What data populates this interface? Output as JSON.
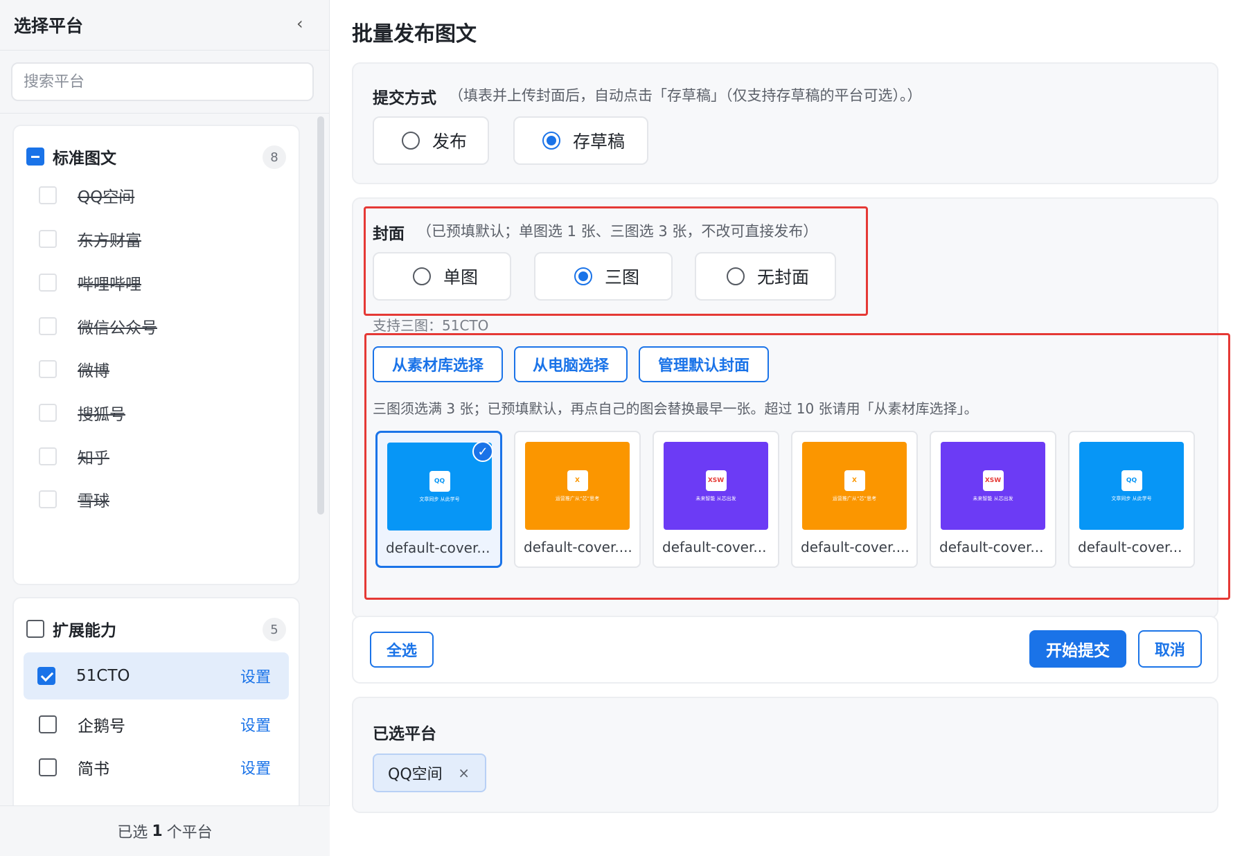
{
  "sidebar": {
    "title": "选择平台",
    "collapse_icon": "‹",
    "search_placeholder": "搜索平台",
    "groups": [
      {
        "name": "标准图文",
        "count": "8",
        "state": "partial",
        "items": [
          {
            "label": "QQ空间",
            "strike": true
          },
          {
            "label": "东方财富",
            "strike": true
          },
          {
            "label": "哔哩哔哩",
            "strike": true
          },
          {
            "label": "微信公众号",
            "strike": true
          },
          {
            "label": "微博",
            "strike": true
          },
          {
            "label": "搜狐号",
            "strike": true
          },
          {
            "label": "知乎",
            "strike": true
          },
          {
            "label": "雪球",
            "strike": true
          }
        ]
      },
      {
        "name": "扩展能力",
        "count": "5",
        "state": "unchecked",
        "items": [
          {
            "label": "51CTO",
            "checked": true,
            "action": "设置"
          },
          {
            "label": "企鹅号",
            "checked": false,
            "action": "设置"
          },
          {
            "label": "简书",
            "checked": false,
            "action": "设置"
          }
        ]
      }
    ],
    "footer": {
      "prefix": "已选",
      "count": "1",
      "suffix": "个平台"
    }
  },
  "main": {
    "title": "批量发布图文",
    "submit": {
      "label": "提交方式",
      "hint": "（填表并上传封面后，自动点击「存草稿」（仅支持存草稿的平台可选）。）",
      "options": [
        "发布",
        "存草稿"
      ],
      "selected": "存草稿"
    },
    "cover": {
      "label": "封面",
      "hint": "（已预填默认；单图选 1 张、三图选 3 张，不改可直接发布）",
      "options": [
        "单图",
        "三图",
        "无封面"
      ],
      "selected": "三图",
      "support_text": "支持三图：51CTO",
      "buttons": [
        "从素材库选择",
        "从电脑选择",
        "管理默认封面"
      ],
      "note": "三图须选满 3 张；已预填默认，再点自己的图会替换最早一张。超过 10 张请用「从素材库选择」。",
      "thumbnails": [
        {
          "name": "default-cover...",
          "color": "#0796f6",
          "logo_text": "QQ",
          "logo_color": "#0796f6",
          "tag": "文章同步 从此学号",
          "selected": true
        },
        {
          "name": "default-cover....",
          "color": "#fb9600",
          "logo_text": "X",
          "logo_color": "#fb9600",
          "tag": "运营推广从“芯”思考",
          "selected": false
        },
        {
          "name": "default-cover...",
          "color": "#6c3bf5",
          "logo_text": "XSW",
          "logo_color": "#e53935",
          "tag": "未来智能 从芯出发",
          "selected": false
        },
        {
          "name": "default-cover....",
          "color": "#fb9600",
          "logo_text": "X",
          "logo_color": "#fb9600",
          "tag": "运营推广从“芯”思考",
          "selected": false
        },
        {
          "name": "default-cover...",
          "color": "#6c3bf5",
          "logo_text": "XSW",
          "logo_color": "#e53935",
          "tag": "未来智能 从芯出发",
          "selected": false
        },
        {
          "name": "default-cover...",
          "color": "#0796f6",
          "logo_text": "QQ",
          "logo_color": "#0796f6",
          "tag": "文章同步 从此学号",
          "selected": false
        }
      ]
    },
    "actions": {
      "select_all": "全选",
      "start": "开始提交",
      "cancel": "取消"
    },
    "selected_platforms": {
      "label": "已选平台",
      "chips": [
        "QQ空间"
      ],
      "chip_close": "×"
    }
  },
  "colors": {
    "accent": "#1a73e8",
    "highlight": "#e53935"
  }
}
